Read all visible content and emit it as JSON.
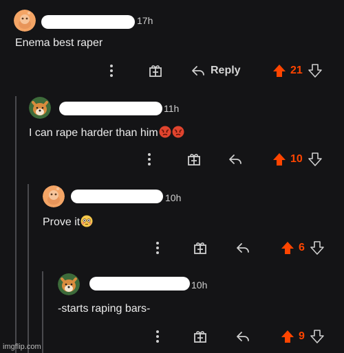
{
  "comments": [
    {
      "avatar_icon": "reddit-snoo-avatar-icon",
      "age": "17h",
      "text": "Enema best raper",
      "emoji": [],
      "reply_label": "Reply",
      "score": "21"
    },
    {
      "avatar_icon": "shiba-dog-avatar-icon",
      "age": "11h",
      "text": "I can rape harder than him",
      "emoji": [
        "angry-face-emoji",
        "angry-face-emoji"
      ],
      "reply_label": "",
      "score": "10"
    },
    {
      "avatar_icon": "reddit-snoo-avatar-icon",
      "age": "10h",
      "text": "Prove it",
      "emoji": [
        "flushed-face-emoji"
      ],
      "reply_label": "",
      "score": "6"
    },
    {
      "avatar_icon": "shiba-dog-avatar-icon",
      "age": "10h",
      "text": "-starts raping bars-",
      "emoji": [],
      "reply_label": "",
      "score": "9"
    }
  ],
  "watermark": "imgflip.com",
  "colors": {
    "background": "#141416",
    "upvote_active": "#ff4500",
    "thread_line": "#4a4a4e",
    "icon": "#cfcfcf"
  }
}
